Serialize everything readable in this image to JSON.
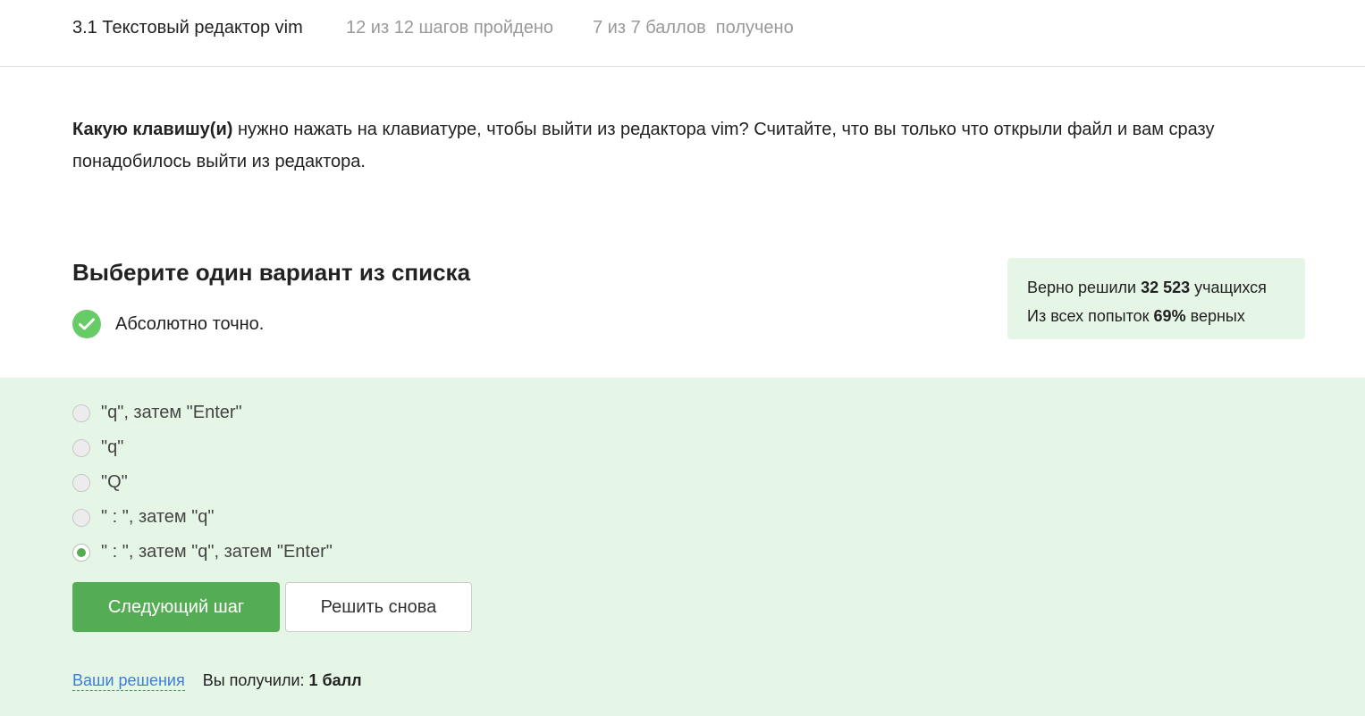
{
  "header": {
    "lesson_title": "3.1 Текстовый редактор vim",
    "steps_progress": "12 из 12 шагов пройдено",
    "points_progress": "7 из 7 баллов  получено"
  },
  "question": {
    "bold_part": "Какую клавишу(и)",
    "rest": " нужно нажать на клавиатуре, чтобы выйти из редактора vim? Считайте, что вы только что открыли файл и вам сразу понадобилось выйти из редактора."
  },
  "quiz": {
    "heading": "Выберите один вариант из списка",
    "feedback": "Абсолютно точно.",
    "options": [
      {
        "label": "\"q\", затем \"Enter\"",
        "selected": false
      },
      {
        "label": "\"q\"",
        "selected": false
      },
      {
        "label": "\"Q\"",
        "selected": false
      },
      {
        "label": "\" : \", затем \"q\"",
        "selected": false
      },
      {
        "label": "\" : \", затем \"q\", затем \"Enter\"",
        "selected": true
      }
    ],
    "next_button": "Следующий шаг",
    "retry_button": "Решить снова"
  },
  "stats": {
    "solved_prefix": "Верно решили ",
    "solved_count": "32 523",
    "solved_suffix": " учащихся",
    "attempts_prefix": "Из всех попыток ",
    "attempts_percent": "69%",
    "attempts_suffix": " верных"
  },
  "footer": {
    "solutions_link": "Ваши решения",
    "received_label": "Вы получили:",
    "received_value": "1 балл"
  },
  "colors": {
    "accent_green": "#54ad54",
    "answer_background": "#e6f6e6",
    "link_blue": "#3a7ed6"
  },
  "icons": {
    "feedback": "check-circle-icon"
  }
}
